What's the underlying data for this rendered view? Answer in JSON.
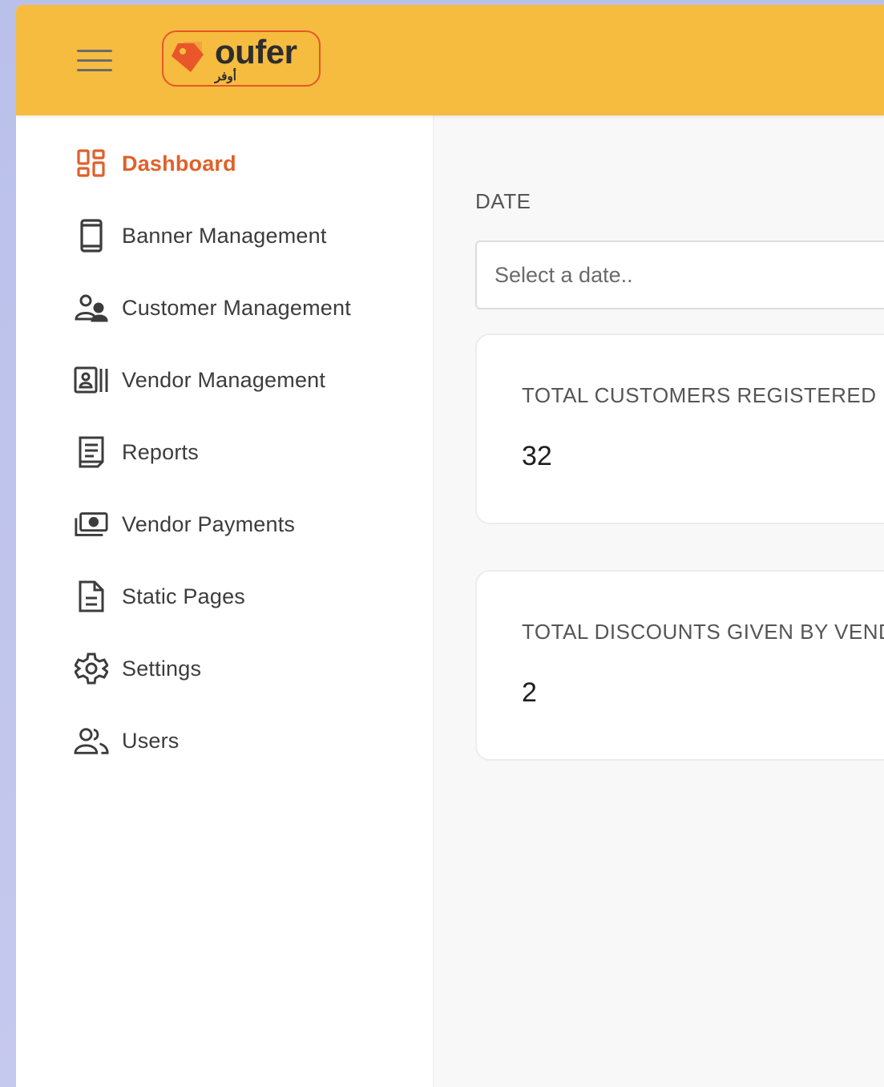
{
  "header": {
    "logo_text": "oufer",
    "logo_subtext": "أوفر",
    "background_color": "#f5bc40",
    "menu_icon": "hamburger-icon"
  },
  "sidebar": {
    "active_color": "#e0602a",
    "items": [
      {
        "label": "Dashboard",
        "icon": "dashboard-icon",
        "active": true
      },
      {
        "label": "Banner Management",
        "icon": "mobile-icon"
      },
      {
        "label": "Customer Management",
        "icon": "user-group-icon"
      },
      {
        "label": "Vendor Management",
        "icon": "id-card-icon"
      },
      {
        "label": "Reports",
        "icon": "report-icon"
      },
      {
        "label": "Vendor Payments",
        "icon": "money-icon"
      },
      {
        "label": "Static Pages",
        "icon": "document-icon"
      },
      {
        "label": "Settings",
        "icon": "gear-icon"
      },
      {
        "label": "Users",
        "icon": "users-icon"
      }
    ]
  },
  "main": {
    "date_label": "DATE",
    "date_placeholder": "Select a date..",
    "cards": [
      {
        "title": "TOTAL CUSTOMERS REGISTERED",
        "value": "32"
      },
      {
        "title": "TOTAL DISCOUNTS GIVEN BY VEND",
        "value": "2"
      }
    ]
  }
}
